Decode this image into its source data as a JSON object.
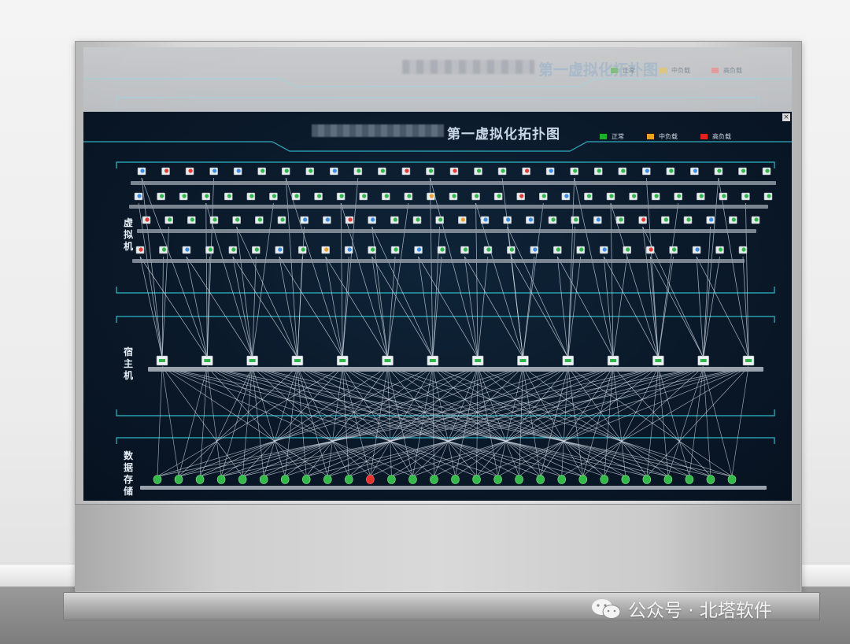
{
  "screen": {
    "title": "第一虚拟化拓扑图",
    "legend": [
      {
        "label": "正常",
        "color": "#19b22a"
      },
      {
        "label": "中负载",
        "color": "#f0a020"
      },
      {
        "label": "高负载",
        "color": "#e8201c"
      }
    ],
    "sections": {
      "vm": "虚拟机",
      "host": "宿主机",
      "storage": "数据存储"
    },
    "close_label": "×"
  },
  "ghost_screen": {
    "title": "第一虚拟化拓扑图",
    "legend": [
      {
        "label": "正常",
        "color": "#7ebd7e"
      },
      {
        "label": "中负载",
        "color": "#e0c57a"
      },
      {
        "label": "高负载",
        "color": "#e39a9a"
      }
    ]
  },
  "watermark": {
    "text": "公众号 · 北塔软件",
    "icon": "wechat-icon"
  },
  "topology": {
    "vm_rows": [
      {
        "colors": [
          "b",
          "r",
          "r",
          "b",
          "b",
          "g",
          "g",
          "g",
          "b",
          "g",
          "g",
          "r",
          "g",
          "r",
          "g",
          "g",
          "r",
          "b",
          "g",
          "g",
          "g",
          "b",
          "g",
          "b",
          "g",
          "g",
          "g"
        ]
      },
      {
        "colors": [
          "b",
          "g",
          "g",
          "g",
          "g",
          "g",
          "g",
          "g",
          "g",
          "g",
          "g",
          "g",
          "g",
          "o",
          "g",
          "g",
          "g",
          "r",
          "g",
          "b",
          "g",
          "g",
          "g",
          "g",
          "g",
          "g",
          "g",
          "g",
          "g"
        ]
      },
      {
        "colors": [
          "r",
          "g",
          "g",
          "g",
          "g",
          "g",
          "g",
          "b",
          "b",
          "r",
          "b",
          "g",
          "g",
          "g",
          "o",
          "b",
          "b",
          "b",
          "g",
          "g",
          "b",
          "g",
          "r",
          "g",
          "g",
          "b",
          "g",
          "g"
        ]
      },
      {
        "colors": [
          "r",
          "g",
          "b",
          "g",
          "g",
          "g",
          "b",
          "g",
          "o",
          "b",
          "g",
          "g",
          "b",
          "g",
          "g",
          "g",
          "g",
          "b",
          "g",
          "g",
          "b",
          "g",
          "r",
          "g",
          "b",
          "g",
          "g"
        ]
      }
    ],
    "host_count": 14,
    "storage_count": 28,
    "storage_alert_index": 10
  }
}
